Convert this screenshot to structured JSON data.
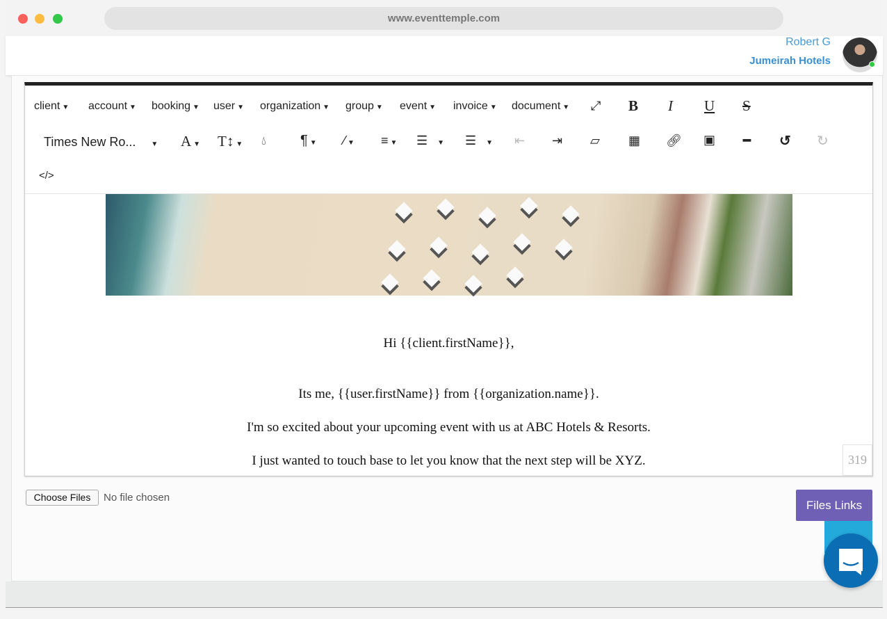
{
  "browser": {
    "url": "www.eventtemple.com"
  },
  "header": {
    "user_name": "Robert G",
    "organization": "Jumeirah Hotels"
  },
  "toolbar": {
    "merge_menus": [
      "client",
      "account",
      "booking",
      "user",
      "organization",
      "group",
      "event",
      "invoice",
      "document"
    ],
    "font_family": "Times New Ro...",
    "icons": [
      "fullscreen-icon",
      "bold-icon",
      "italic-icon",
      "underline-icon",
      "strikethrough-icon",
      "font-size-icon",
      "text-height-icon",
      "color-icon",
      "paragraph-icon",
      "magic-icon",
      "align-icon",
      "ordered-list-icon",
      "unordered-list-icon",
      "outdent-icon",
      "indent-icon",
      "eraser-icon",
      "table-icon",
      "link-icon",
      "image-icon",
      "horizontal-rule-icon",
      "undo-icon",
      "redo-icon",
      "code-view-icon"
    ]
  },
  "content": {
    "lines": [
      "Hi {{client.firstName}},",
      "Its me, {{user.firstName}} from {{organization.name}}.",
      "I'm so excited about your upcoming event with us at ABC Hotels & Resorts.",
      "I just wanted to touch base to let you know that the next step will be XYZ."
    ],
    "char_count": "319"
  },
  "files": {
    "choose_label": "Choose Files",
    "status": "No file chosen",
    "files_links_label": "Files Links"
  },
  "colors": {
    "accent": "#6f5fb5",
    "link": "#3a8fd0",
    "chat": "#0b6db3",
    "save": "#24a9db"
  }
}
